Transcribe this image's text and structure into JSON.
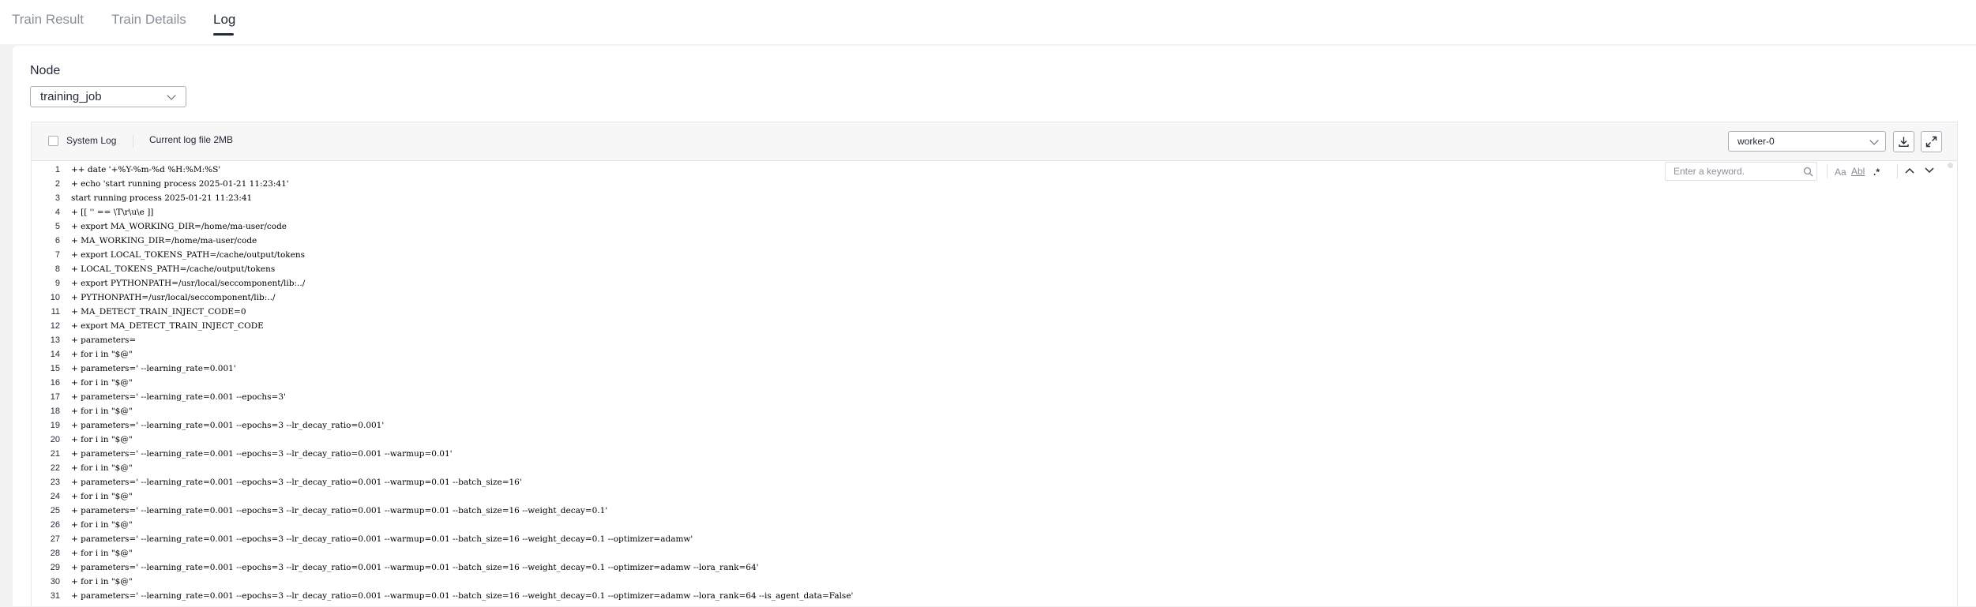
{
  "tabs": [
    {
      "label": "Train Result",
      "active": false
    },
    {
      "label": "Train Details",
      "active": false
    },
    {
      "label": "Log",
      "active": true
    }
  ],
  "node": {
    "label": "Node",
    "value": "training_job"
  },
  "log_toolbar": {
    "system_log_label": "System Log",
    "system_log_checked": false,
    "current_log_text": "Current log file 2MB",
    "worker_value": "worker-0",
    "download_icon": "download-icon",
    "fullscreen_icon": "fullscreen-icon"
  },
  "find": {
    "placeholder": "Enter a keyword.",
    "match_case": "Aa",
    "match_word": "Abl",
    "regex": ".*"
  },
  "log_lines": [
    {
      "n": "1",
      "t": "++ date '+%Y-%m-%d %H:%M:%S'"
    },
    {
      "n": "2",
      "t": "+ echo 'start running process 2025-01-21 11:23:41'"
    },
    {
      "n": "3",
      "t": "start running process 2025-01-21 11:23:41"
    },
    {
      "n": "4",
      "t": "+ [[ '' == \\T\\r\\u\\e ]]"
    },
    {
      "n": "5",
      "t": "+ export MA_WORKING_DIR=/home/ma-user/code"
    },
    {
      "n": "6",
      "t": "+ MA_WORKING_DIR=/home/ma-user/code"
    },
    {
      "n": "7",
      "t": "+ export LOCAL_TOKENS_PATH=/cache/output/tokens"
    },
    {
      "n": "8",
      "t": "+ LOCAL_TOKENS_PATH=/cache/output/tokens"
    },
    {
      "n": "9",
      "t": "+ export PYTHONPATH=/usr/local/seccomponent/lib:../"
    },
    {
      "n": "10",
      "t": "+ PYTHONPATH=/usr/local/seccomponent/lib:../"
    },
    {
      "n": "11",
      "t": "+ MA_DETECT_TRAIN_INJECT_CODE=0"
    },
    {
      "n": "12",
      "t": "+ export MA_DETECT_TRAIN_INJECT_CODE"
    },
    {
      "n": "13",
      "t": "+ parameters="
    },
    {
      "n": "14",
      "t": "+ for i in \"$@\""
    },
    {
      "n": "15",
      "t": "+ parameters=' --learning_rate=0.001'"
    },
    {
      "n": "16",
      "t": "+ for i in \"$@\""
    },
    {
      "n": "17",
      "t": "+ parameters=' --learning_rate=0.001 --epochs=3'"
    },
    {
      "n": "18",
      "t": "+ for i in \"$@\""
    },
    {
      "n": "19",
      "t": "+ parameters=' --learning_rate=0.001 --epochs=3 --lr_decay_ratio=0.001'"
    },
    {
      "n": "20",
      "t": "+ for i in \"$@\""
    },
    {
      "n": "21",
      "t": "+ parameters=' --learning_rate=0.001 --epochs=3 --lr_decay_ratio=0.001 --warmup=0.01'"
    },
    {
      "n": "22",
      "t": "+ for i in \"$@\""
    },
    {
      "n": "23",
      "t": "+ parameters=' --learning_rate=0.001 --epochs=3 --lr_decay_ratio=0.001 --warmup=0.01 --batch_size=16'"
    },
    {
      "n": "24",
      "t": "+ for i in \"$@\""
    },
    {
      "n": "25",
      "t": "+ parameters=' --learning_rate=0.001 --epochs=3 --lr_decay_ratio=0.001 --warmup=0.01 --batch_size=16 --weight_decay=0.1'"
    },
    {
      "n": "26",
      "t": "+ for i in \"$@\""
    },
    {
      "n": "27",
      "t": "+ parameters=' --learning_rate=0.001 --epochs=3 --lr_decay_ratio=0.001 --warmup=0.01 --batch_size=16 --weight_decay=0.1 --optimizer=adamw'"
    },
    {
      "n": "28",
      "t": "+ for i in \"$@\""
    },
    {
      "n": "29",
      "t": "+ parameters=' --learning_rate=0.001 --epochs=3 --lr_decay_ratio=0.001 --warmup=0.01 --batch_size=16 --weight_decay=0.1 --optimizer=adamw --lora_rank=64'"
    },
    {
      "n": "30",
      "t": "+ for i in \"$@\""
    },
    {
      "n": "31",
      "t": "+ parameters=' --learning_rate=0.001 --epochs=3 --lr_decay_ratio=0.001 --warmup=0.01 --batch_size=16 --weight_decay=0.1 --optimizer=adamw --lora_rank=64 --is_agent_data=False'"
    }
  ]
}
